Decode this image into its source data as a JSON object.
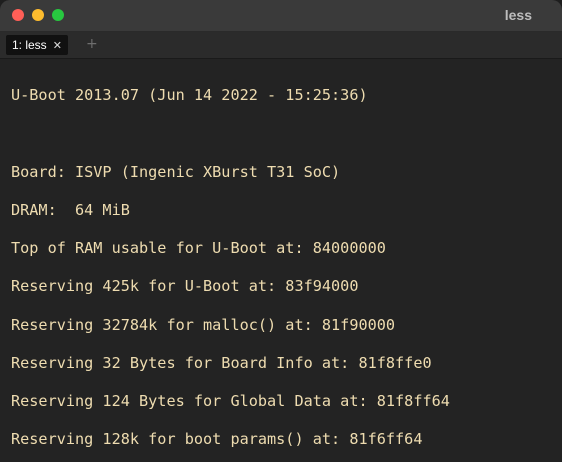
{
  "window": {
    "title": "less",
    "controls": {
      "close_color": "#ff5f57",
      "minimize_color": "#febc2e",
      "zoom_color": "#28c840"
    }
  },
  "tabs": [
    {
      "label": "1: less",
      "close_icon": "close-icon"
    }
  ],
  "new_tab_icon": "plus-icon",
  "terminal": {
    "text_color": "#eedcb0",
    "lines": [
      "U-Boot 2013.07 (Jun 14 2022 - 15:25:36)",
      "Board: ISVP (Ingenic XBurst T31 SoC)",
      "DRAM:  64 MiB",
      "Top of RAM usable for U-Boot at: 84000000",
      "Reserving 425k for U-Boot at: 83f94000",
      "Reserving 32784k for malloc() at: 81f90000",
      "Reserving 32 Bytes for Board Info at: 81f8ffe0",
      "Reserving 124 Bytes for Global Data at: 81f8ff64",
      "Reserving 128k for boot params() at: 81f6ff64"
    ]
  }
}
